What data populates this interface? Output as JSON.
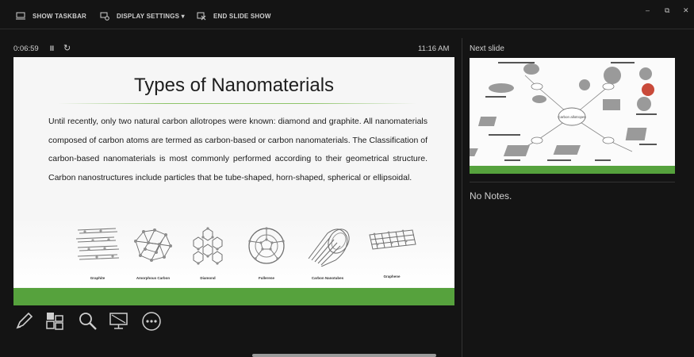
{
  "toolbar": {
    "show_taskbar": "SHOW TASKBAR",
    "display_settings": "DISPLAY SETTINGS ▾",
    "end_slide_show": "END SLIDE SHOW",
    "icons": [
      "taskbar-icon",
      "display-settings-icon",
      "end-slideshow-icon"
    ]
  },
  "window_controls": {
    "minimize": "–",
    "restore": "⧉",
    "close": "✕"
  },
  "presenter": {
    "timer": "0:06:59",
    "pause_glyph": "II",
    "restart_glyph": "↻",
    "clock": "11:16 AM"
  },
  "slide": {
    "title": "Types of Nanomaterials",
    "body": "Until recently, only two natural carbon allotropes were known: diamond and graphite. All nanomaterials composed of carbon atoms are termed as carbon-based or carbon nanomaterials. The Classification of carbon-based nanomaterials is most commonly performed according to their geometrical structure. Carbon nanostructures include particles that be tube-shaped, horn-shaped, spherical or ellipsoidal.",
    "figures": [
      "Graphite",
      "Amorphous Carbon",
      "Diamond",
      "Fullerene",
      "Carbon Nanotubes",
      "Graphene"
    ],
    "accent_color": "#56a23d"
  },
  "tools": [
    "pen-icon",
    "all-slides-icon",
    "zoom-icon",
    "screen-icon",
    "more-options-icon"
  ],
  "next_slide": {
    "label": "Next slide",
    "center_label": "Carbon allotropes"
  },
  "notes": "No Notes."
}
